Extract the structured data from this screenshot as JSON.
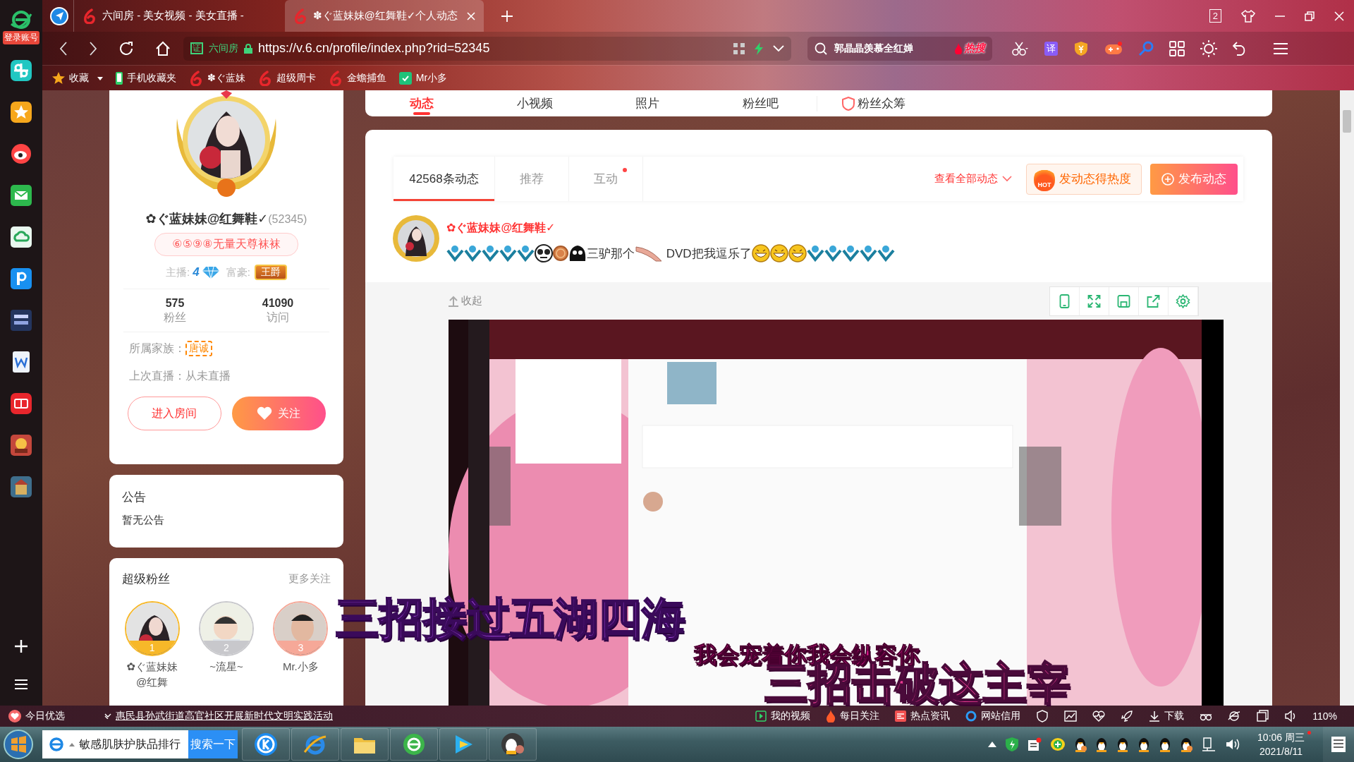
{
  "sidebar": {
    "login_badge": "登录账号"
  },
  "browser": {
    "tabs": [
      {
        "title": "六间房 - 美女视频 - 美女直播 -",
        "selected": false
      },
      {
        "title": "✽ぐ蓝妹妹@红舞鞋✓个人动态",
        "selected": true
      }
    ],
    "window_count": "2",
    "address": {
      "cert_badge": "证",
      "site": "六间房",
      "url": "https://v.6.cn/profile/index.php?rid=52345"
    },
    "search": {
      "value": "郭晶晶羡慕全红婵",
      "hot_label": "热搜"
    },
    "translate_badge": "译",
    "bookmarks": [
      {
        "kind": "star",
        "label": "收藏"
      },
      {
        "kind": "phone",
        "label": "手机收藏夹"
      },
      {
        "kind": "six",
        "label": "✽ぐ蓝妹"
      },
      {
        "kind": "six",
        "label": "超级周卡"
      },
      {
        "kind": "six",
        "label": "金蟾捕鱼"
      },
      {
        "kind": "game",
        "label": "Mr小多"
      }
    ]
  },
  "nav": [
    {
      "label": "动态",
      "selected": true
    },
    {
      "label": "小视频",
      "selected": false
    },
    {
      "label": "照片",
      "selected": false
    },
    {
      "label": "粉丝吧",
      "selected": false
    },
    {
      "label": "粉丝众筹",
      "selected": false
    }
  ],
  "profile": {
    "name": "✿ぐ蓝妹妹@红舞鞋✓",
    "rid": "(52345)",
    "slogan": "⑥⑤⑨⑧无量天尊袜袜",
    "anchor_label": "主播:",
    "anchor_level": "4",
    "rich_label": "富豪:",
    "rich_badge": "王爵",
    "stats": [
      {
        "value": "575",
        "label": "粉丝"
      },
      {
        "value": "41090",
        "label": "访问"
      }
    ],
    "family_label": "所属家族：",
    "family": "唐诚",
    "last_live": "上次直播：从未直播",
    "enter_button": "进入房间",
    "follow_button": "关注"
  },
  "notice": {
    "title": "公告",
    "text": "暂无公告"
  },
  "super_fans": {
    "title": "超级粉丝",
    "more": "更多关注",
    "fans": [
      {
        "rank": "1",
        "name": "✿ぐ蓝妹妹@红舞",
        "color": "#f7b829"
      },
      {
        "rank": "2",
        "name": "~流星~",
        "color": "#c8c8cc"
      },
      {
        "rank": "3",
        "name": "Mr.小多",
        "color": "#f6a898"
      }
    ]
  },
  "feed": {
    "tabs": [
      {
        "label": "42568条动态",
        "selected": true,
        "dot": false
      },
      {
        "label": "推荐",
        "selected": false,
        "dot": false
      },
      {
        "label": "互动",
        "selected": false,
        "dot": true
      }
    ],
    "view_all": "查看全部动态",
    "hot_badge": "HOT",
    "hot_button": "发动态得热度",
    "publish_button": "发布动态",
    "post": {
      "author": "✿ぐ蓝妹妹@红舞鞋✓",
      "content": [
        {
          "kind": "v5"
        },
        {
          "kind": "v5"
        },
        {
          "kind": "v5"
        },
        {
          "kind": "v5"
        },
        {
          "kind": "v5"
        },
        {
          "kind": "panda"
        },
        {
          "kind": "coin"
        },
        {
          "kind": "blob"
        },
        {
          "kind": "text",
          "text": "三驴那个"
        },
        {
          "kind": "leg"
        },
        {
          "kind": "text",
          "text": " DVD把我逗乐了"
        },
        {
          "kind": "grin"
        },
        {
          "kind": "grin"
        },
        {
          "kind": "grin"
        },
        {
          "kind": "v5"
        },
        {
          "kind": "v5"
        },
        {
          "kind": "v5"
        },
        {
          "kind": "v5"
        },
        {
          "kind": "v5"
        }
      ]
    },
    "collapse": "收起"
  },
  "lyrics": [
    {
      "text": "三招接过五湖四海"
    },
    {
      "text": "我会宠着你我会纵容你"
    },
    {
      "text": "三招击破这主宰"
    }
  ],
  "status_bar": {
    "news_label": "今日优选",
    "headline": "惠民县孙武街道高官社区开展新时代文明实践活动",
    "links": [
      {
        "kind": "video",
        "label": "我的视频"
      },
      {
        "kind": "fire",
        "label": "每日关注"
      },
      {
        "kind": "news",
        "label": "热点资讯"
      },
      {
        "kind": "credit",
        "label": "网站信用"
      }
    ],
    "download": "下载",
    "zoom": "110%"
  },
  "taskbar": {
    "search": {
      "value": "敏感肌肤护肤品排行",
      "button": "搜索一下"
    },
    "time": "10:06 周三",
    "date": "2021/8/11"
  }
}
